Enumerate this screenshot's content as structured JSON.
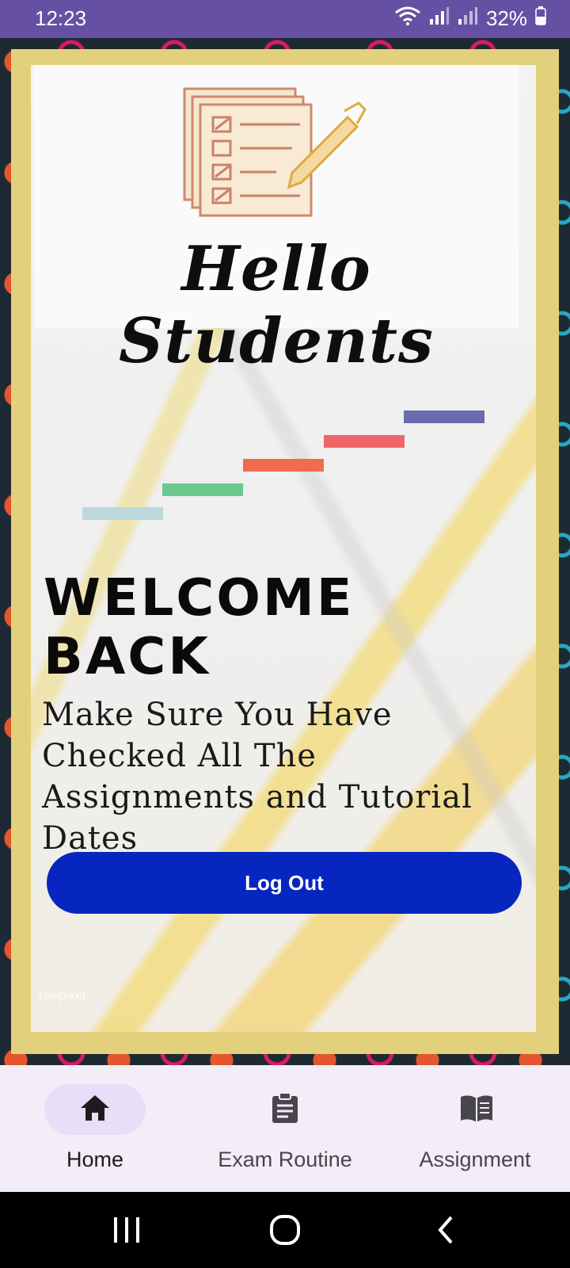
{
  "status_bar": {
    "time": "12:23",
    "battery": "32%"
  },
  "header": {
    "title": "Hello Students"
  },
  "main": {
    "welcome": "WELCOME BACK",
    "reminder": "Make Sure You Have Checked All The Assignments and Tutorial Dates",
    "logout_label": "Log Out",
    "watermark": "rawpixel",
    "step_colors": [
      "#bcd8dc",
      "#6cc98e",
      "#f26b4d",
      "#f0656a",
      "#6a6aae"
    ]
  },
  "bottom_nav": {
    "items": [
      {
        "label": "Home",
        "icon": "home-icon",
        "active": true
      },
      {
        "label": "Exam Routine",
        "icon": "clipboard-icon",
        "active": false
      },
      {
        "label": "Assignment",
        "icon": "book-icon",
        "active": false
      }
    ]
  },
  "colors": {
    "status_bar": "#6650a4",
    "frame": "#e2d07d",
    "button": "#0726c0",
    "nav_bg": "#f3edf7",
    "nav_active_pill": "#e8def8"
  }
}
